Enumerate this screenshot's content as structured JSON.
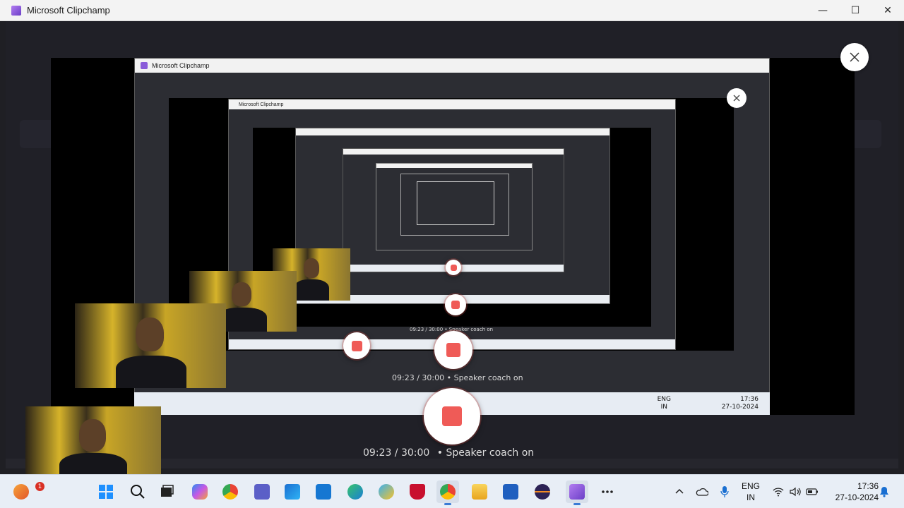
{
  "window": {
    "title": "Microsoft Clipchamp",
    "minimize": "—",
    "maximize": "☐",
    "close": "✕"
  },
  "recorder": {
    "timer": "09:23 / 30:00",
    "separator": "•",
    "coach": "Speaker coach on"
  },
  "nested": {
    "title": "Microsoft Clipchamp",
    "timer_line": "09:23 / 30:00  • Speaker coach on",
    "lang_top": "ENG",
    "lang_bottom": "IN",
    "time": "17:36",
    "date": "27-10-2024"
  },
  "taskbar": {
    "widget_badge": "1",
    "apps": [
      "weather-widget-icon",
      "start-icon",
      "search-icon",
      "task-view-icon",
      "copilot-icon",
      "chrome-icon",
      "teams-icon",
      "store-icon",
      "myhp-icon",
      "edge-icon",
      "phone-link-icon",
      "mcafee-icon",
      "chrome-profile-icon",
      "file-explorer-icon",
      "word-icon",
      "eclipse-icon",
      "clipchamp-icon",
      "more-icon"
    ],
    "tray": {
      "lang_top": "ENG",
      "lang_bottom": "IN",
      "time": "17:36",
      "date": "27-10-2024"
    }
  },
  "colors": {
    "record": "#ef5b57",
    "taskbar": "#e8eef6",
    "stage": "#202027"
  }
}
